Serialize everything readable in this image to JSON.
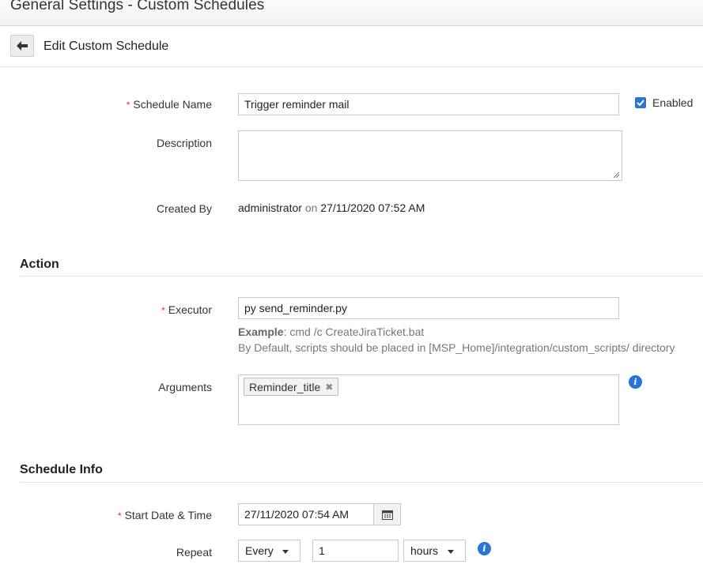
{
  "window": {
    "title": "General Settings - Custom Schedules"
  },
  "header": {
    "heading": "Edit Custom Schedule"
  },
  "form": {
    "schedule_name": {
      "label": "Schedule Name",
      "value": "Trigger reminder mail",
      "required_mark": "*"
    },
    "enabled": {
      "label": "Enabled",
      "checked": true
    },
    "description": {
      "label": "Description",
      "value": ""
    },
    "created_by": {
      "label": "Created By",
      "user": "administrator",
      "on_text": "on",
      "timestamp": "27/11/2020 07:52 AM"
    }
  },
  "action": {
    "section_title": "Action",
    "executor": {
      "label": "Executor",
      "value": "py send_reminder.py",
      "required_mark": "*"
    },
    "example_label": "Example",
    "example_text": ": cmd /c CreateJiraTicket.bat",
    "default_note": "By Default, scripts should be placed in [MSP_Home]/integration/custom_scripts/ directory",
    "arguments": {
      "label": "Arguments",
      "tags": [
        "Reminder_title"
      ],
      "remove_glyph": "✖"
    }
  },
  "schedule_info": {
    "section_title": "Schedule Info",
    "start": {
      "label": "Start Date & Time",
      "value": "27/11/2020 07:54 AM",
      "required_mark": "*"
    },
    "repeat": {
      "label": "Repeat",
      "mode": "Every",
      "interval": "1",
      "unit": "hours"
    }
  },
  "icons": {
    "back": "arrow-left-icon",
    "checkbox": "checkmark-icon",
    "calendar": "calendar-icon",
    "info": "info-icon",
    "info_glyph": "i"
  },
  "colors": {
    "accent": "#2b73d6",
    "required": "#d9342b"
  }
}
